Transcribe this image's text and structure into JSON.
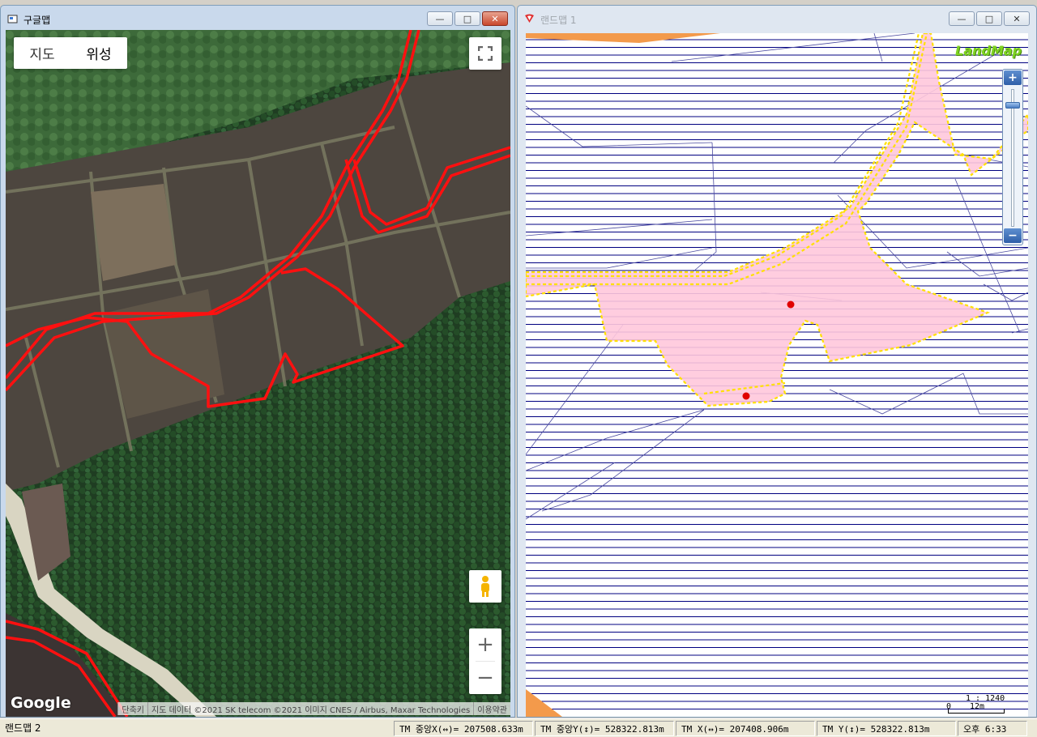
{
  "left_window": {
    "title": "구글맵",
    "controls": {
      "minimize": "—",
      "maximize": "□",
      "close": "✕"
    },
    "map_type": {
      "options": [
        "지도",
        "위성"
      ],
      "selected": "위성"
    },
    "google_logo": "Google",
    "attribution": [
      "단축키",
      "지도 데이터 ©2021 SK telecom ©2021 이미지 CNES / Airbus, Maxar Technologies",
      "이용약관"
    ]
  },
  "right_window": {
    "title": "랜드맵 1",
    "controls": {
      "minimize": "—",
      "maximize": "□",
      "close": "✕"
    },
    "logo": "LandMap",
    "zoom": {
      "in": "+",
      "out": "−"
    },
    "scale": {
      "ratio": "1 : 1240",
      "zero": "0",
      "length": "12m"
    }
  },
  "statusbar": {
    "app_name": "랜드맵 2",
    "tm_center_x": "TM 중앙X(↔)= 207508.633m",
    "tm_center_y": "TM 중앙Y(↕)= 528322.813m",
    "tm_x": "TM X(↔)= 207408.906m",
    "tm_y": "TM Y(↕)= 528322.813m",
    "clock": "오후 6:33"
  },
  "colors": {
    "parcel_fill": "#ffc8dc",
    "parcel_outline": "#ffe000",
    "hatch": "#000080",
    "route": "#ff1010"
  }
}
